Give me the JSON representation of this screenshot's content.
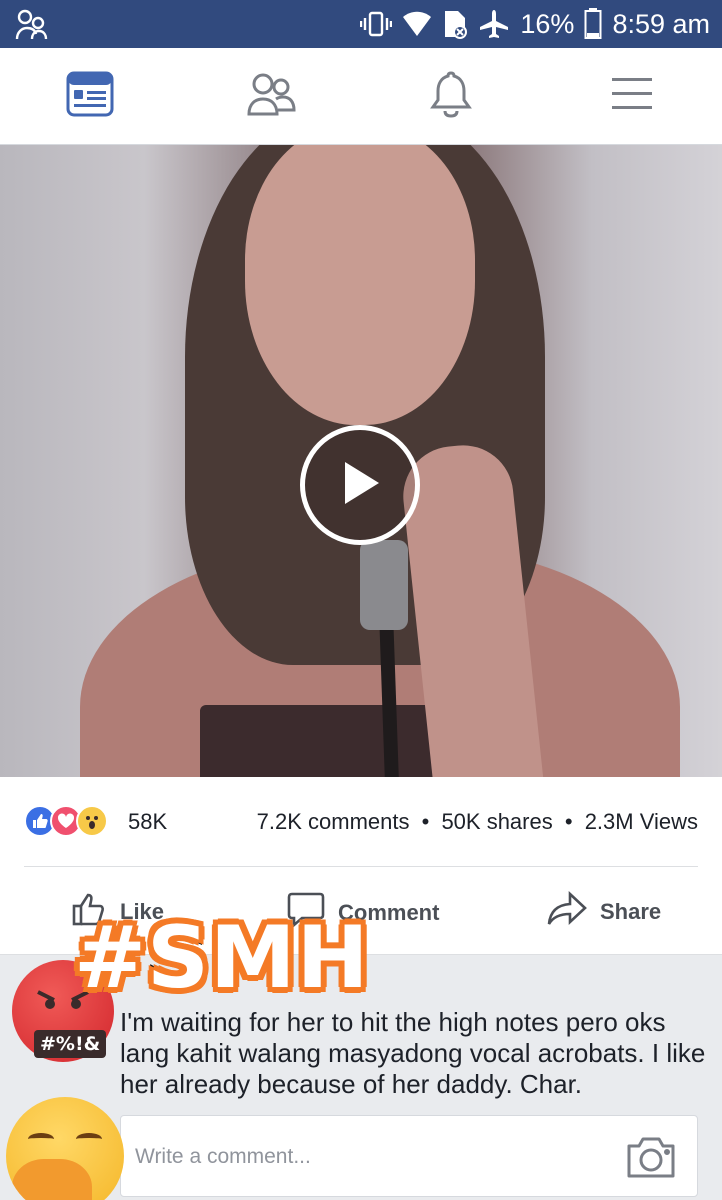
{
  "status_bar": {
    "battery": "16%",
    "time": "8:59 am",
    "icons": [
      "people-icon",
      "vibrate-icon",
      "wifi-icon",
      "sim-icon",
      "airplane-icon",
      "battery-icon"
    ]
  },
  "nav": {
    "tabs": [
      {
        "icon": "news-feed-icon",
        "active": true
      },
      {
        "icon": "friends-icon",
        "active": false
      },
      {
        "icon": "notifications-bell-icon",
        "active": false
      },
      {
        "icon": "menu-icon",
        "active": false
      }
    ],
    "accent_color": "#4267b2"
  },
  "video": {
    "play_icon": "play-icon"
  },
  "stats": {
    "reaction_icons": [
      "like-reaction-icon",
      "love-reaction-icon",
      "wow-reaction-icon"
    ],
    "reaction_count": "58K",
    "comments": "7.2K comments",
    "separator": "•",
    "shares": "50K shares",
    "views": "2.3M Views"
  },
  "actions": {
    "like": "Like",
    "comment": "Comment",
    "share": "Share"
  },
  "comment": {
    "text": "I'm waiting for her to hit the high notes pero oks lang kahit walang masyadong vocal acrobats. I like her already because of her daddy. Char."
  },
  "composer": {
    "placeholder": "Write a comment..."
  },
  "stickers": {
    "hashtag": "#SMH",
    "angry_symbols": "#%!&"
  }
}
